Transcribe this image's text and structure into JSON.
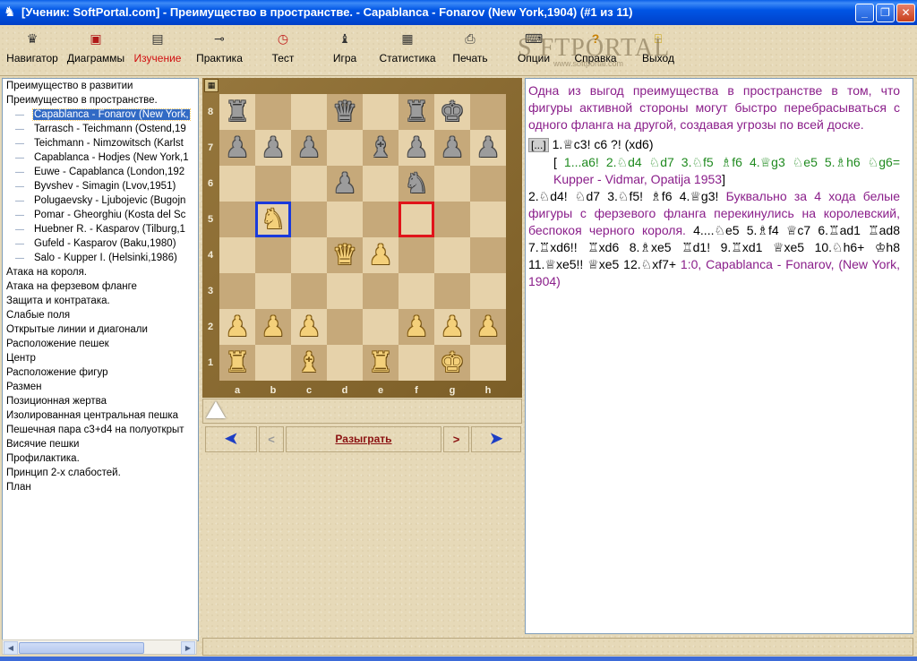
{
  "window": {
    "title": "[Ученик: SoftPortal.com]  -  Преимущество в пространстве.  - Capablanca - Fonarov (New York,1904) (#1 из 11)",
    "minimize": "_",
    "maximize": "❐",
    "close": "✕"
  },
  "toolbar": [
    {
      "label": "Навигатор",
      "icon": "♛"
    },
    {
      "label": "Диаграммы",
      "icon": "▣"
    },
    {
      "label": "Изучение",
      "icon": "▤"
    },
    {
      "label": "Практика",
      "icon": "⊸"
    },
    {
      "label": "Тест",
      "icon": "◷"
    },
    {
      "label": "Игра",
      "icon": "♝"
    },
    {
      "label": "Статистика",
      "icon": "▦"
    },
    {
      "label": "Печать",
      "icon": "⎙"
    },
    {
      "label": "Опции",
      "icon": "⌨"
    },
    {
      "label": "Справка",
      "icon": "?"
    },
    {
      "label": "Выход",
      "icon": "⍐"
    }
  ],
  "watermark": {
    "big": "S   FTPORTAL",
    "small": "www.softportal.com"
  },
  "tree": [
    {
      "label": "Преимущество в развитии",
      "level": 0
    },
    {
      "label": "Преимущество в пространстве.",
      "level": 0
    },
    {
      "label": "Capablanca - Fonarov (New York,",
      "level": 1,
      "selected": true
    },
    {
      "label": "Tarrasch - Teichmann (Ostend,19",
      "level": 1
    },
    {
      "label": "Teichmann - Nimzowitsch (Karlst",
      "level": 1
    },
    {
      "label": "Capablanca - Hodjes (New York,1",
      "level": 1
    },
    {
      "label": "Euwe - Capablanca (London,192",
      "level": 1
    },
    {
      "label": "Byvshev - Simagin (Lvov,1951)",
      "level": 1
    },
    {
      "label": "Polugaevsky - Ljubojevic (Bugojn",
      "level": 1
    },
    {
      "label": "Pomar - Gheorghiu (Kosta del Sc",
      "level": 1
    },
    {
      "label": "Huebner R. - Kasparov (Tilburg,1",
      "level": 1
    },
    {
      "label": "Gufeld - Kasparov (Baku,1980)",
      "level": 1
    },
    {
      "label": "Salo - Kupper I. (Helsinki,1986)",
      "level": 1
    },
    {
      "label": "Атака на короля.",
      "level": 0
    },
    {
      "label": "Атака на ферзевом фланге",
      "level": 0
    },
    {
      "label": "Защита и контратака.",
      "level": 0
    },
    {
      "label": "Слабые поля",
      "level": 0
    },
    {
      "label": "Открытые линии и диагонали",
      "level": 0
    },
    {
      "label": "Расположение пешек",
      "level": 0
    },
    {
      "label": "Центр",
      "level": 0
    },
    {
      "label": "Расположение фигур",
      "level": 0
    },
    {
      "label": "Размен",
      "level": 0
    },
    {
      "label": "Позиционная жертва",
      "level": 0
    },
    {
      "label": "Изолированная центральная пешка",
      "level": 0
    },
    {
      "label": "Пешечная пара c3+d4 на полуоткрыт",
      "level": 0
    },
    {
      "label": "Висячие пешки",
      "level": 0
    },
    {
      "label": "Профилактика.",
      "level": 0
    },
    {
      "label": "Принцип 2-х слабостей.",
      "level": 0
    },
    {
      "label": "План",
      "level": 0
    }
  ],
  "board": {
    "ranks": [
      "8",
      "7",
      "6",
      "5",
      "4",
      "3",
      "2",
      "1"
    ],
    "files": [
      "a",
      "b",
      "c",
      "d",
      "e",
      "f",
      "g",
      "h"
    ],
    "rows": [
      [
        "",
        "",
        "",
        "",
        "",
        "",
        "",
        ""
      ],
      [
        "",
        "",
        "",
        "",
        "",
        "",
        "",
        ""
      ],
      [
        "",
        "",
        "",
        "",
        "",
        "",
        "",
        ""
      ],
      [
        "",
        "",
        "",
        "",
        "",
        "",
        "",
        ""
      ],
      [
        "",
        "",
        "",
        "",
        "",
        "",
        "",
        ""
      ],
      [
        "",
        "",
        "",
        "",
        "",
        "",
        "",
        ""
      ],
      [
        "",
        "",
        "",
        "",
        "",
        "",
        "",
        ""
      ],
      [
        "",
        "",
        "",
        "",
        "",
        "",
        "",
        ""
      ]
    ],
    "pieces": {
      "a8": "br",
      "d8": "bq",
      "f8": "br",
      "g8": "bk",
      "a7": "bp",
      "b7": "bp",
      "c7": "bp",
      "e7": "bb",
      "f7": "bp",
      "g7": "bp",
      "h7": "bp",
      "d6": "bp",
      "f6": "bn",
      "b5": "wn",
      "d4": "wq",
      "e4": "wp",
      "a2": "wp",
      "b2": "wp",
      "c2": "wp",
      "f2": "wp",
      "g2": "wp",
      "h2": "wp",
      "a1": "wr",
      "c1": "wb",
      "e1": "wr",
      "g1": "wk"
    },
    "highlight_from": "b5",
    "highlight_to": "f5"
  },
  "nav": {
    "first": "➤",
    "prev": "<",
    "play": "Разыграть",
    "next": ">",
    "last": "➤"
  },
  "annotation": {
    "intro": "Одна из выгод преимущества в пространстве в том, что фигуры активной стороны могут быстро перебрасываться с одного фланга на другой, создавая угрозы по всей доске.",
    "ellipsis": "[...]",
    "line1": "1.♕c3! c6 ?! (xd6)",
    "var_open": "[",
    "var_moves": "1...a6! 2.♘d4 ♘d7 3.♘f5 ♗f6 4.♕g3 ♘e5  5.♗h6 ♘g6=",
    "var_tail": "Kupper - Vidmar, Opatija 1953",
    "var_close": "]",
    "line2": "2.♘d4! ♘d7 3.♘f5! ♗f6 4.♕g3!",
    "comment2": "Буквально за 4  хода белые фигуры с ферзевого фланга перекинулись на королевский, беспокоя черного короля.",
    "line3": "4....♘e5 5.♗f4 ♕c7 6.♖ad1 ♖ad8 7.♖xd6!! ♖xd6 8.♗xe5 ♖d1! 9.♖xd1 ♕xe5 10.♘h6+ ♔h8 11.♕xe5!! ♕xe5 12.♘xf7+",
    "result": "1:0, Capablanca - Fonarov, (New York, 1904)"
  },
  "colors": {
    "purple": "#8a1e8a",
    "green": "#1f8a1f",
    "selection": "#316ac5",
    "from_highlight": "#1a3adb",
    "to_highlight": "#e0141a"
  }
}
